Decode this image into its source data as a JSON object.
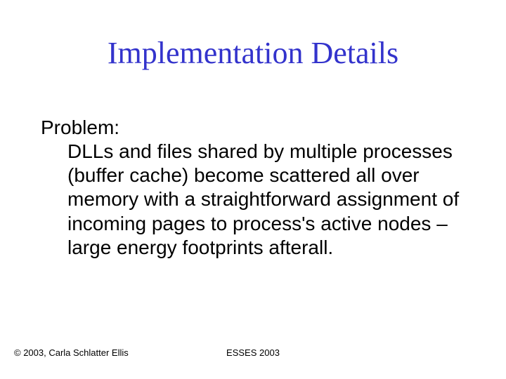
{
  "title": "Implementation Details",
  "body": {
    "label": "Problem:",
    "text": "DLLs and files shared by multiple processes (buffer cache) become scattered all over memory with a straightforward assignment of incoming pages to process's active nodes – large energy footprints afterall."
  },
  "footer": {
    "left": "© 2003, Carla Schlatter Ellis",
    "center": "ESSES 2003"
  }
}
